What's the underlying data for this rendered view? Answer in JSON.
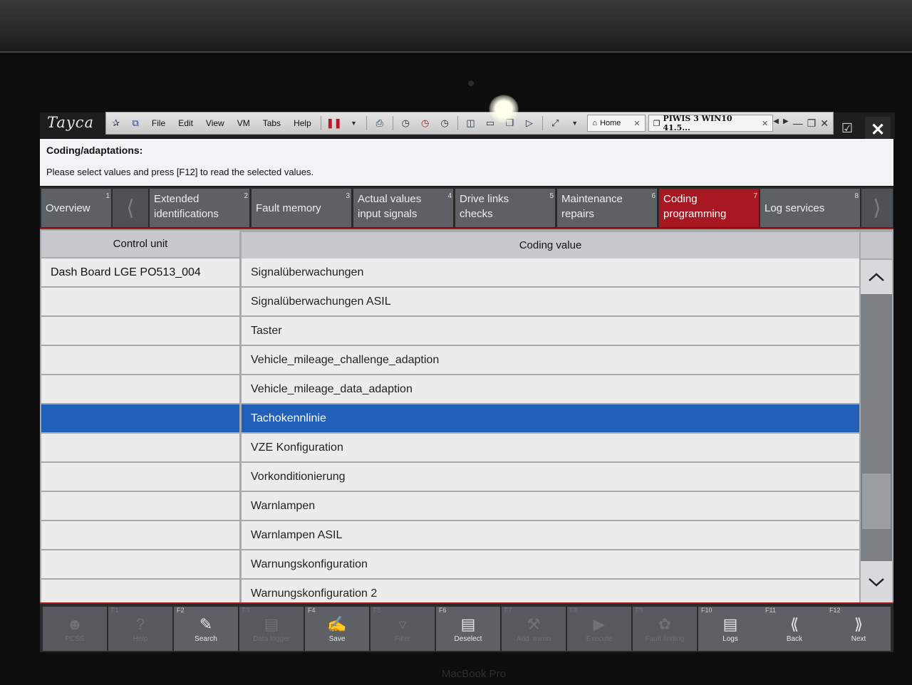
{
  "app": {
    "brand": "Tayca",
    "menu": [
      "File",
      "Edit",
      "View",
      "VM",
      "Tabs",
      "Help"
    ],
    "vm_tabs": [
      {
        "label": "Home"
      },
      {
        "label": "PIWIS 3 WIN10 41.5..."
      }
    ]
  },
  "info": {
    "title": "Coding/adaptations:",
    "text": "Please select values and press [F12] to read the selected values."
  },
  "tabs": [
    {
      "num": "1",
      "line1": "Overview",
      "line2": ""
    },
    {
      "num": "2",
      "line1": "Extended",
      "line2": "identifications"
    },
    {
      "num": "3",
      "line1": "Fault memory",
      "line2": ""
    },
    {
      "num": "4",
      "line1": "Actual values",
      "line2": "input signals"
    },
    {
      "num": "5",
      "line1": "Drive links",
      "line2": "checks"
    },
    {
      "num": "6",
      "line1": "Maintenance",
      "line2": "repairs"
    },
    {
      "num": "7",
      "line1": "Coding",
      "line2": "programming",
      "active": true
    },
    {
      "num": "8",
      "line1": "Log services",
      "line2": ""
    }
  ],
  "table": {
    "col_control_unit": "Control unit",
    "col_coding_value": "Coding value",
    "rows": [
      {
        "cu": "Dash Board LGE PO513_004",
        "value": "Signalüberwachungen"
      },
      {
        "cu": "",
        "value": "Signalüberwachungen ASIL"
      },
      {
        "cu": "",
        "value": "Taster"
      },
      {
        "cu": "",
        "value": "Vehicle_mileage_challenge_adaption"
      },
      {
        "cu": "",
        "value": "Vehicle_mileage_data_adaption"
      },
      {
        "cu": "",
        "value": "Tachokennlinie",
        "selected": true
      },
      {
        "cu": "",
        "value": "VZE Konfiguration"
      },
      {
        "cu": "",
        "value": "Vorkonditionierung"
      },
      {
        "cu": "",
        "value": "Warnlampen"
      },
      {
        "cu": "",
        "value": "Warnlampen ASIL"
      },
      {
        "cu": "",
        "value": "Warnungskonfiguration"
      },
      {
        "cu": "",
        "value": "Warnungskonfiguration 2"
      }
    ]
  },
  "fkeys": [
    {
      "key": "",
      "label": "PCSS",
      "icon": "person-icon",
      "enabled": false
    },
    {
      "key": "F1",
      "label": "Help",
      "icon": "help-icon",
      "enabled": false
    },
    {
      "key": "F2",
      "label": "Search",
      "icon": "search-icon",
      "enabled": true
    },
    {
      "key": "F3",
      "label": "Data logger",
      "icon": "chart-icon",
      "enabled": false
    },
    {
      "key": "F4",
      "label": "Save",
      "icon": "save-icon",
      "enabled": true
    },
    {
      "key": "F5",
      "label": "Filter",
      "icon": "filter-icon",
      "enabled": false
    },
    {
      "key": "F6",
      "label": "Deselect",
      "icon": "deselect-icon",
      "enabled": true
    },
    {
      "key": "F7",
      "label": "Add. menu",
      "icon": "tools-icon",
      "enabled": false
    },
    {
      "key": "F8",
      "label": "Execute",
      "icon": "play-icon",
      "enabled": false
    },
    {
      "key": "F9",
      "label": "Fault finding",
      "icon": "fault-icon",
      "enabled": false
    },
    {
      "key": "F10",
      "label": "Logs",
      "icon": "logs-icon",
      "enabled": true
    },
    {
      "key": "F11",
      "label": "Back",
      "icon": "back-icon",
      "enabled": true
    },
    {
      "key": "F12",
      "label": "Next",
      "icon": "next-icon",
      "enabled": true
    }
  ],
  "bottom_brand": "MacBook Pro"
}
